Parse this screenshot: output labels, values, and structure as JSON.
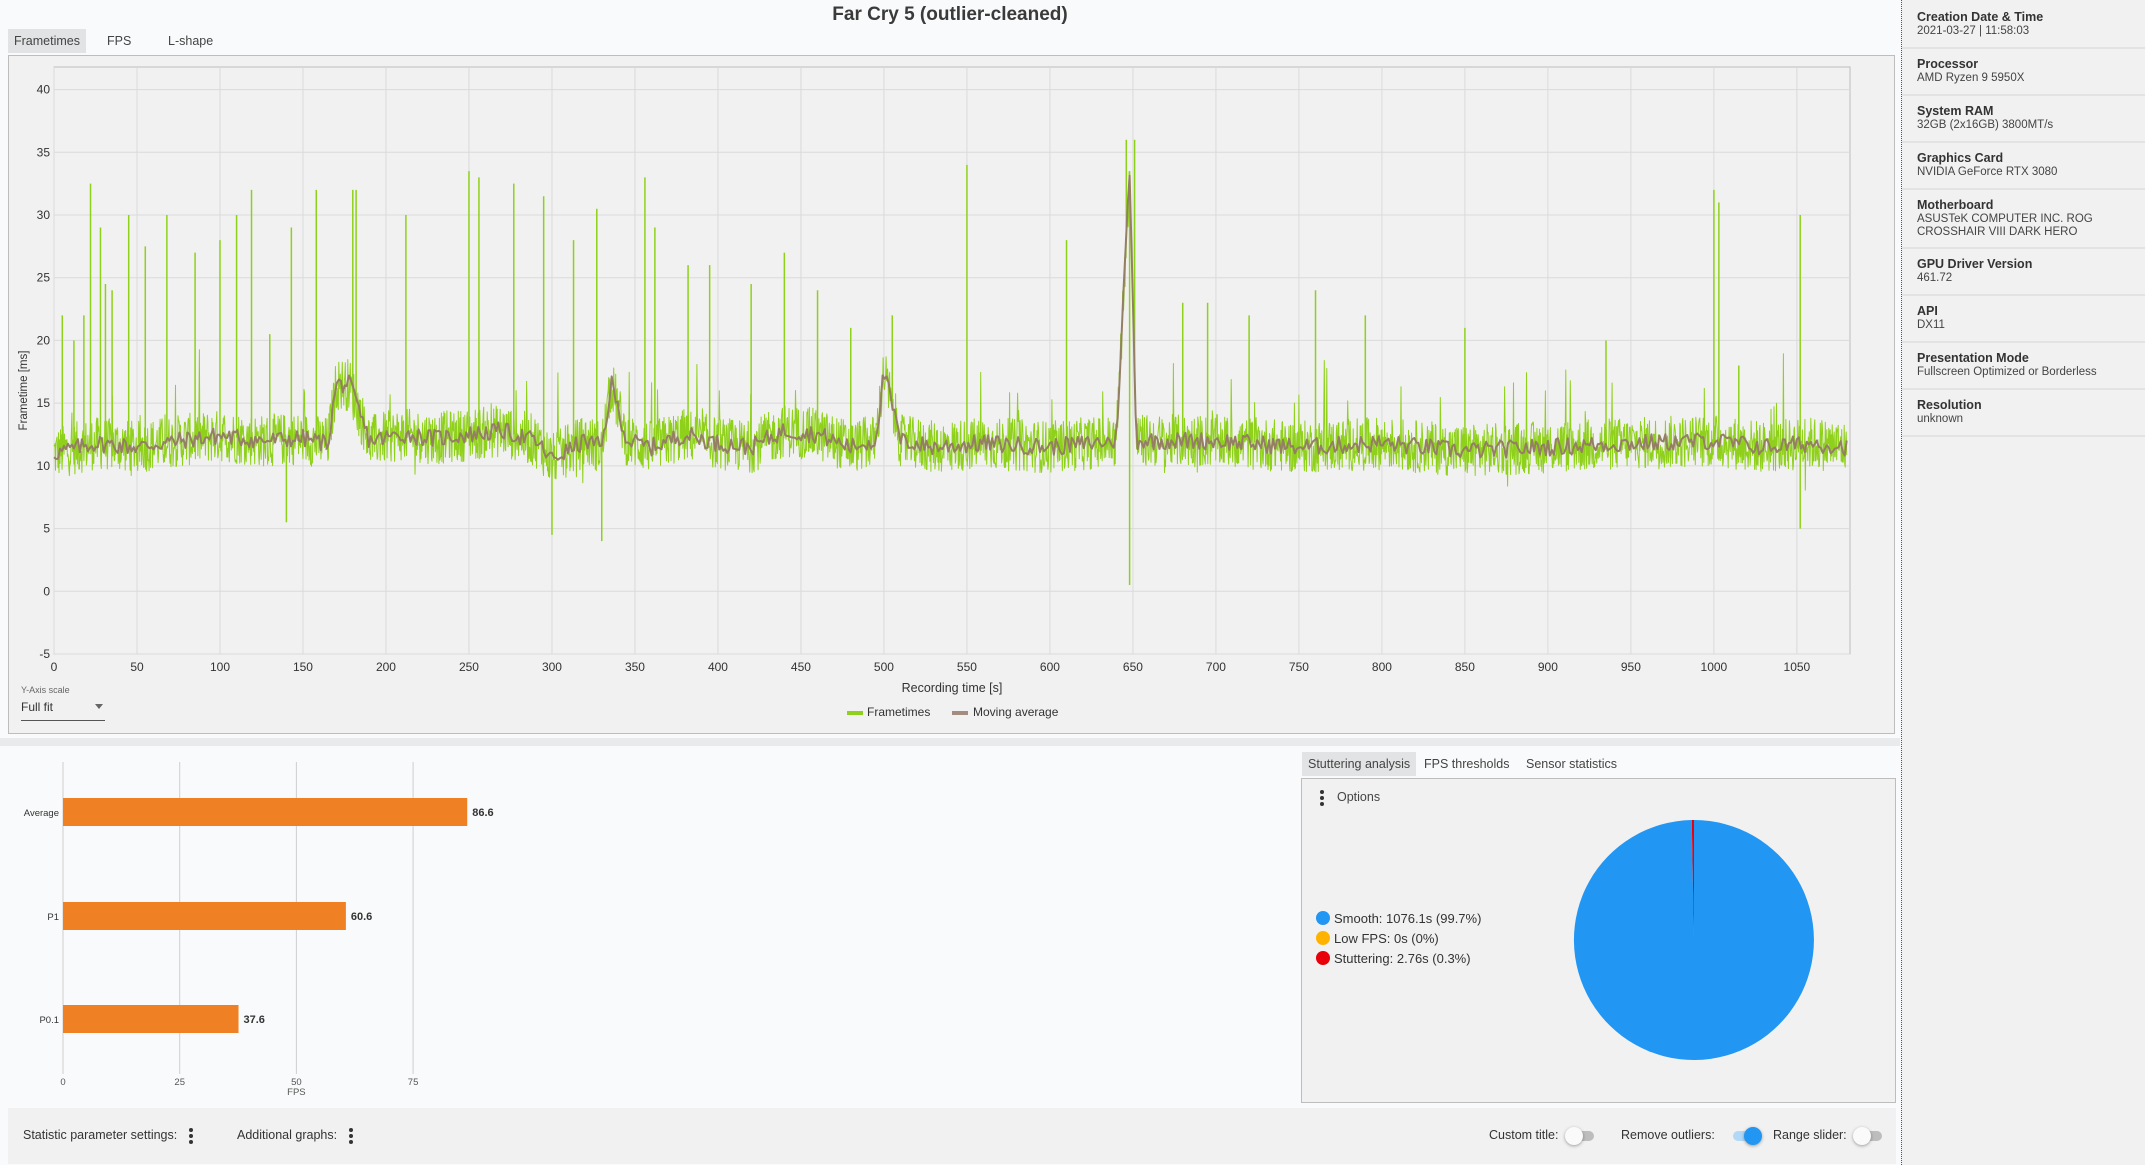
{
  "title": "Far Cry 5 (outlier-cleaned)",
  "tabs": [
    {
      "label": "Frametimes",
      "active": true
    },
    {
      "label": "FPS",
      "active": false
    },
    {
      "label": "L-shape",
      "active": false
    }
  ],
  "y_axis_scale": {
    "label": "Y-Axis scale",
    "value": "Full fit"
  },
  "colors": {
    "frametimes": "#8fd11a",
    "moving_average": "#947f64",
    "bar": "#f08024",
    "smooth": "#2196f3",
    "low_fps": "#ffb300",
    "stuttering": "#e8000b",
    "toggle_on": "#2196f3"
  },
  "chart_data": [
    {
      "type": "line",
      "title": "Far Cry 5 (outlier-cleaned)",
      "xlabel": "Recording time [s]",
      "ylabel": "Frametime [ms]",
      "xlim": [
        0,
        1082
      ],
      "ylim": [
        -5,
        42
      ],
      "x_ticks": [
        0,
        50,
        100,
        150,
        200,
        250,
        300,
        350,
        400,
        450,
        500,
        550,
        600,
        650,
        700,
        750,
        800,
        850,
        900,
        950,
        1000,
        1050
      ],
      "y_ticks": [
        -5,
        0,
        5,
        10,
        15,
        20,
        25,
        30,
        35,
        40
      ],
      "grid": true,
      "legend": {
        "position": "bottom-center",
        "entries": [
          "Frametimes",
          "Moving average"
        ]
      },
      "series": [
        {
          "name": "Moving average",
          "x": [
            0,
            25,
            50,
            75,
            100,
            125,
            150,
            165,
            170,
            178,
            190,
            210,
            230,
            250,
            270,
            290,
            300,
            320,
            330,
            336,
            345,
            360,
            380,
            400,
            420,
            440,
            460,
            480,
            495,
            500,
            510,
            530,
            560,
            600,
            640,
            648,
            652,
            660,
            700,
            750,
            800,
            850,
            900,
            950,
            1000,
            1030,
            1060,
            1080
          ],
          "y": [
            11,
            11.8,
            11.5,
            12,
            12.4,
            12,
            12.2,
            11.8,
            16.5,
            16.5,
            12,
            12.5,
            12.2,
            12.5,
            12.8,
            12,
            10.5,
            12,
            11.5,
            16.5,
            12,
            11.5,
            12.5,
            11.8,
            11.5,
            12.8,
            12.5,
            11.5,
            12,
            17.5,
            12,
            11.5,
            11.8,
            11.5,
            12,
            33.5,
            12,
            12,
            12,
            11.5,
            11.8,
            11.2,
            11.5,
            11.8,
            12,
            11.5,
            11.8,
            11.5
          ]
        },
        {
          "name": "Frametimes",
          "baseline": "moving average ± ~2 ms noise",
          "spikes": [
            {
              "x": 5,
              "y": 22
            },
            {
              "x": 12,
              "y": 20
            },
            {
              "x": 18,
              "y": 22
            },
            {
              "x": 22,
              "y": 32.5
            },
            {
              "x": 28,
              "y": 29
            },
            {
              "x": 31,
              "y": 24.5
            },
            {
              "x": 35,
              "y": 24
            },
            {
              "x": 45,
              "y": 30
            },
            {
              "x": 55,
              "y": 27.5
            },
            {
              "x": 68,
              "y": 30
            },
            {
              "x": 85,
              "y": 27
            },
            {
              "x": 100,
              "y": 28
            },
            {
              "x": 110,
              "y": 30
            },
            {
              "x": 119,
              "y": 32
            },
            {
              "x": 130,
              "y": 20.5
            },
            {
              "x": 143,
              "y": 29
            },
            {
              "x": 158,
              "y": 32
            },
            {
              "x": 180,
              "y": 32
            },
            {
              "x": 182,
              "y": 32
            },
            {
              "x": 212,
              "y": 30
            },
            {
              "x": 250,
              "y": 33.5
            },
            {
              "x": 256,
              "y": 33
            },
            {
              "x": 277,
              "y": 32.5
            },
            {
              "x": 295,
              "y": 31.5
            },
            {
              "x": 313,
              "y": 28
            },
            {
              "x": 327,
              "y": 30.5
            },
            {
              "x": 356,
              "y": 33
            },
            {
              "x": 362,
              "y": 29
            },
            {
              "x": 382,
              "y": 26
            },
            {
              "x": 395,
              "y": 26
            },
            {
              "x": 420,
              "y": 24.5
            },
            {
              "x": 440,
              "y": 27
            },
            {
              "x": 460,
              "y": 24
            },
            {
              "x": 480,
              "y": 21
            },
            {
              "x": 505,
              "y": 22
            },
            {
              "x": 550,
              "y": 34
            },
            {
              "x": 610,
              "y": 28
            },
            {
              "x": 646,
              "y": 36
            },
            {
              "x": 651,
              "y": 36
            },
            {
              "x": 680,
              "y": 23
            },
            {
              "x": 695,
              "y": 23
            },
            {
              "x": 720,
              "y": 22
            },
            {
              "x": 760,
              "y": 24
            },
            {
              "x": 790,
              "y": 22
            },
            {
              "x": 850,
              "y": 21
            },
            {
              "x": 935,
              "y": 20
            },
            {
              "x": 1000,
              "y": 32
            },
            {
              "x": 1003,
              "y": 31
            },
            {
              "x": 1015,
              "y": 18
            },
            {
              "x": 1052,
              "y": 30
            }
          ],
          "dips": [
            {
              "x": 300,
              "y": 4.5
            },
            {
              "x": 330,
              "y": 4
            },
            {
              "x": 648,
              "y": 0.5
            },
            {
              "x": 140,
              "y": 5.5
            },
            {
              "x": 1052,
              "y": 5
            }
          ]
        }
      ]
    },
    {
      "type": "bar",
      "orientation": "horizontal",
      "categories": [
        "Average",
        "P1",
        "P0.1"
      ],
      "values": [
        86.6,
        60.6,
        37.6
      ],
      "xlabel": "FPS",
      "x_ticks": [
        0,
        25,
        50,
        75
      ],
      "xlim": [
        0,
        100
      ],
      "grid": true
    },
    {
      "type": "pie",
      "labels": [
        "Smooth",
        "Low FPS",
        "Stuttering"
      ],
      "values": [
        99.7,
        0,
        0.3
      ],
      "legend_text": [
        "Smooth:  1076.1s (99.7%)",
        "Low FPS:  0s (0%)",
        "Stuttering:  2.76s (0.3%)"
      ],
      "legend": {
        "position": "left"
      }
    }
  ],
  "stutter_tabs": [
    {
      "label": "Stuttering analysis",
      "active": true
    },
    {
      "label": "FPS thresholds",
      "active": false
    },
    {
      "label": "Sensor statistics",
      "active": false
    }
  ],
  "options_label": "Options",
  "toolbar": {
    "statistic_params": "Statistic parameter settings:",
    "additional_graphs": "Additional graphs:",
    "custom_title": "Custom title:",
    "remove_outliers": "Remove outliers:",
    "range_slider": "Range slider:",
    "custom_title_on": false,
    "remove_outliers_on": true,
    "range_slider_on": false
  },
  "sidebar": [
    {
      "key": "Creation Date & Time",
      "value": "2021-03-27  |  11:58:03"
    },
    {
      "key": "Processor",
      "value": "AMD Ryzen 9 5950X"
    },
    {
      "key": "System RAM",
      "value": "32GB (2x16GB) 3800MT/s"
    },
    {
      "key": "Graphics Card",
      "value": "NVIDIA GeForce RTX 3080"
    },
    {
      "key": "Motherboard",
      "value": "ASUSTeK COMPUTER INC. ROG CROSSHAIR VIII DARK HERO"
    },
    {
      "key": "GPU Driver Version",
      "value": "461.72"
    },
    {
      "key": "API",
      "value": "DX11"
    },
    {
      "key": "Presentation Mode",
      "value": "Fullscreen Optimized or Borderless"
    },
    {
      "key": "Resolution",
      "value": "unknown"
    }
  ]
}
